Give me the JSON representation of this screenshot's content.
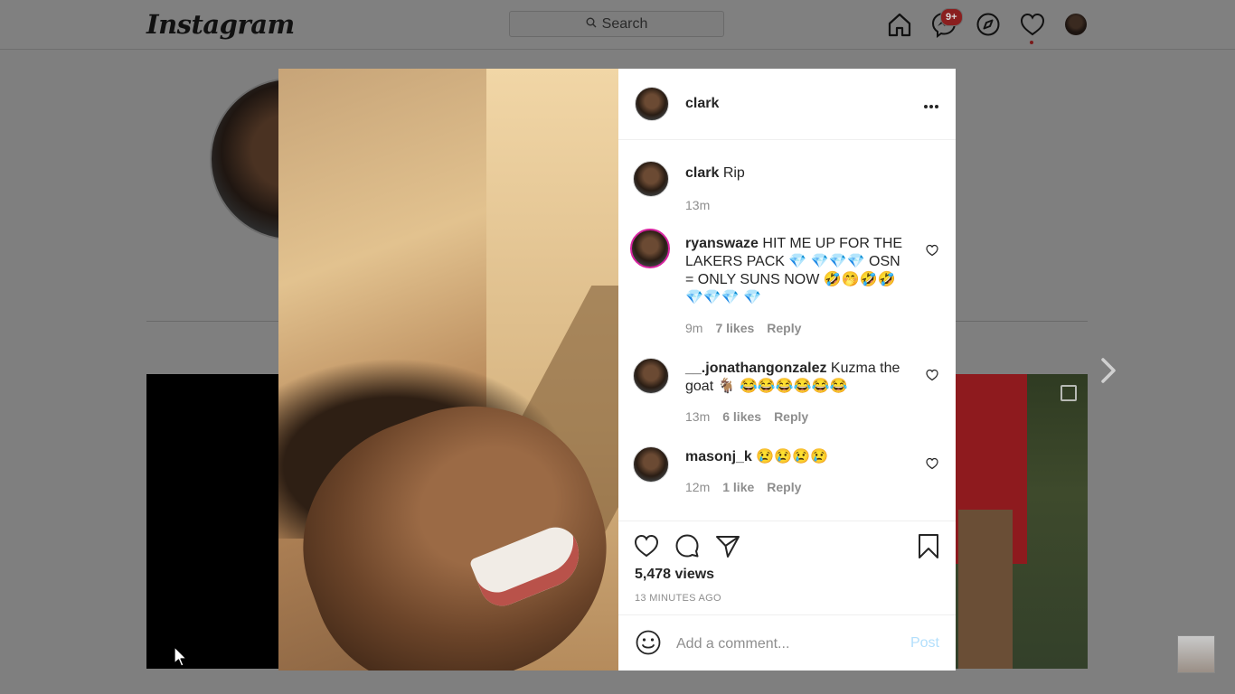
{
  "topbar": {
    "logo": "Instagram",
    "search_placeholder": "Search",
    "notification_badge": "9+"
  },
  "post": {
    "username": "clark",
    "caption_user": "clark",
    "caption_text": " Rip",
    "caption_time": "13m",
    "views": "5,478 views",
    "time_ago": "13 MINUTES AGO"
  },
  "comments": [
    {
      "user": "ryanswaze",
      "text": " HIT ME UP FOR THE LAKERS PACK 💎 💎💎💎 OSN = ONLY SUNS NOW 🤣🤭🤣🤣💎💎💎 💎",
      "time": "9m",
      "likes": "7 likes",
      "reply": "Reply"
    },
    {
      "user": "__.jonathangonzalez",
      "text": " Kuzma the goat 🐐 😂😂😂😂😂😂",
      "time": "13m",
      "likes": "6 likes",
      "reply": "Reply"
    },
    {
      "user": "masonj_k",
      "text": " 😢😢😢😢",
      "time": "12m",
      "likes": "1 like",
      "reply": "Reply"
    }
  ],
  "add_comment": {
    "placeholder": "Add a comment...",
    "post_label": "Post"
  },
  "colors": {
    "accent_blue_disabled": "#b2dffc",
    "text_primary": "#262626",
    "text_secondary": "#8e8e8e",
    "story_ring": "#d6249f"
  },
  "icons": [
    "home-icon",
    "messenger-icon",
    "explore-icon",
    "heart-icon",
    "more-icon",
    "comment-icon",
    "share-icon",
    "bookmark-icon",
    "emoji-icon",
    "chevron-right-icon"
  ]
}
